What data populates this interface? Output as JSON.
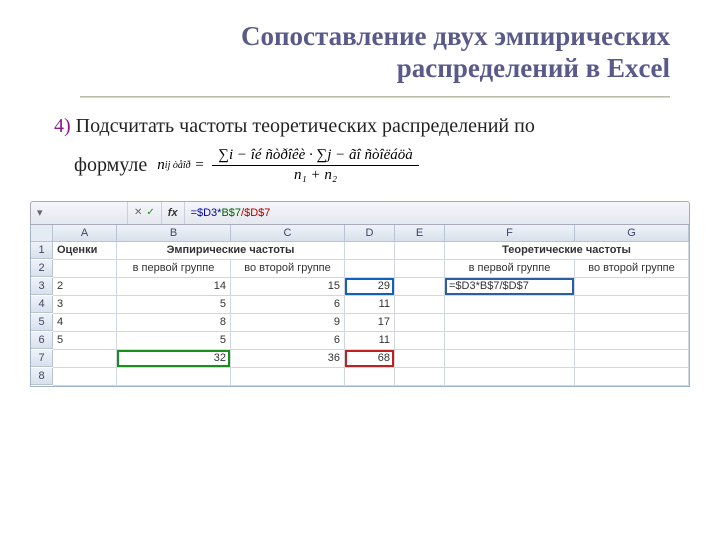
{
  "title_line1": "Сопоставление двух эмпирических",
  "title_line2": "распределений в Excel",
  "item_num": "4)",
  "item_text": "Подсчитать частоты теоретических распределений по",
  "formula_word": "формуле",
  "formula": {
    "lhs_n": "n",
    "lhs_sub": "ij òåîð",
    "eq": "=",
    "top": "∑i − îé  ñòðîêè   ·  ∑j − ãî  ñòîëáöà",
    "bot": "n₁ + n₂"
  },
  "excel": {
    "formula_bar": {
      "blue": "=$D3*",
      "green": "B$7",
      "red": "/$D$7"
    },
    "cols": [
      "A",
      "B",
      "C",
      "D",
      "E",
      "F",
      "G"
    ],
    "row1": {
      "A": "Оценки",
      "BC": "Эмпирические частоты",
      "FG": "Теоретические частоты"
    },
    "row2": {
      "B": "в первой группе",
      "C": "во второй группе",
      "F": "в первой группе",
      "G": "во второй группе"
    },
    "data": [
      {
        "A": "2",
        "B": "14",
        "C": "15",
        "D": "29",
        "F": "=$D3*B$7/$D$7"
      },
      {
        "A": "3",
        "B": "5",
        "C": "6",
        "D": "11"
      },
      {
        "A": "4",
        "B": "8",
        "C": "9",
        "D": "17"
      },
      {
        "A": "5",
        "B": "5",
        "C": "6",
        "D": "11"
      },
      {
        "A": "",
        "B": "32",
        "C": "36",
        "D": "68"
      }
    ]
  }
}
